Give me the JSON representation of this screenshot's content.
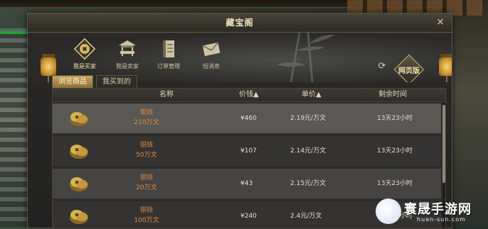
{
  "window": {
    "title": "藏宝阁",
    "close_label": "×"
  },
  "nav": [
    {
      "label": "我是买家",
      "icon": "coin-seal-icon"
    },
    {
      "label": "我是卖家",
      "icon": "stall-icon"
    },
    {
      "label": "订单管理",
      "icon": "ledger-icon"
    },
    {
      "label": "短消息",
      "icon": "envelope-icon"
    }
  ],
  "refresh": {
    "icon": "refresh-icon",
    "glyph": "⟳"
  },
  "web_version": {
    "label": "网页版"
  },
  "tabs": [
    {
      "label": "浏览商品",
      "active": true
    },
    {
      "label": "我买到的",
      "active": false
    }
  ],
  "table": {
    "headers": {
      "name": "名称",
      "price": "价钱▲",
      "unit_price": "单价▲",
      "time_left": "剩余时间"
    },
    "rows": [
      {
        "item": "铜钱",
        "qty": "210万文",
        "price": "¥460",
        "unit_price": "2.19元/万文",
        "time_left": "13天23小时"
      },
      {
        "item": "铜钱",
        "qty": "50万文",
        "price": "¥107",
        "unit_price": "2.14元/万文",
        "time_left": "13天23小时"
      },
      {
        "item": "铜钱",
        "qty": "20万文",
        "price": "¥43",
        "unit_price": "2.15元/万文",
        "time_left": "13天23小时"
      },
      {
        "item": "铜钱",
        "qty": "100万文",
        "price": "¥240",
        "unit_price": "2.4元/万文",
        "time_left": "13天23小时"
      }
    ]
  },
  "watermark": {
    "title": "寰晟手游网",
    "url": "huan-sun.com"
  },
  "colors": {
    "accent_gold": "#c8a45c",
    "item_orange": "#e08a40",
    "panel_dark": "#2c2b29"
  }
}
